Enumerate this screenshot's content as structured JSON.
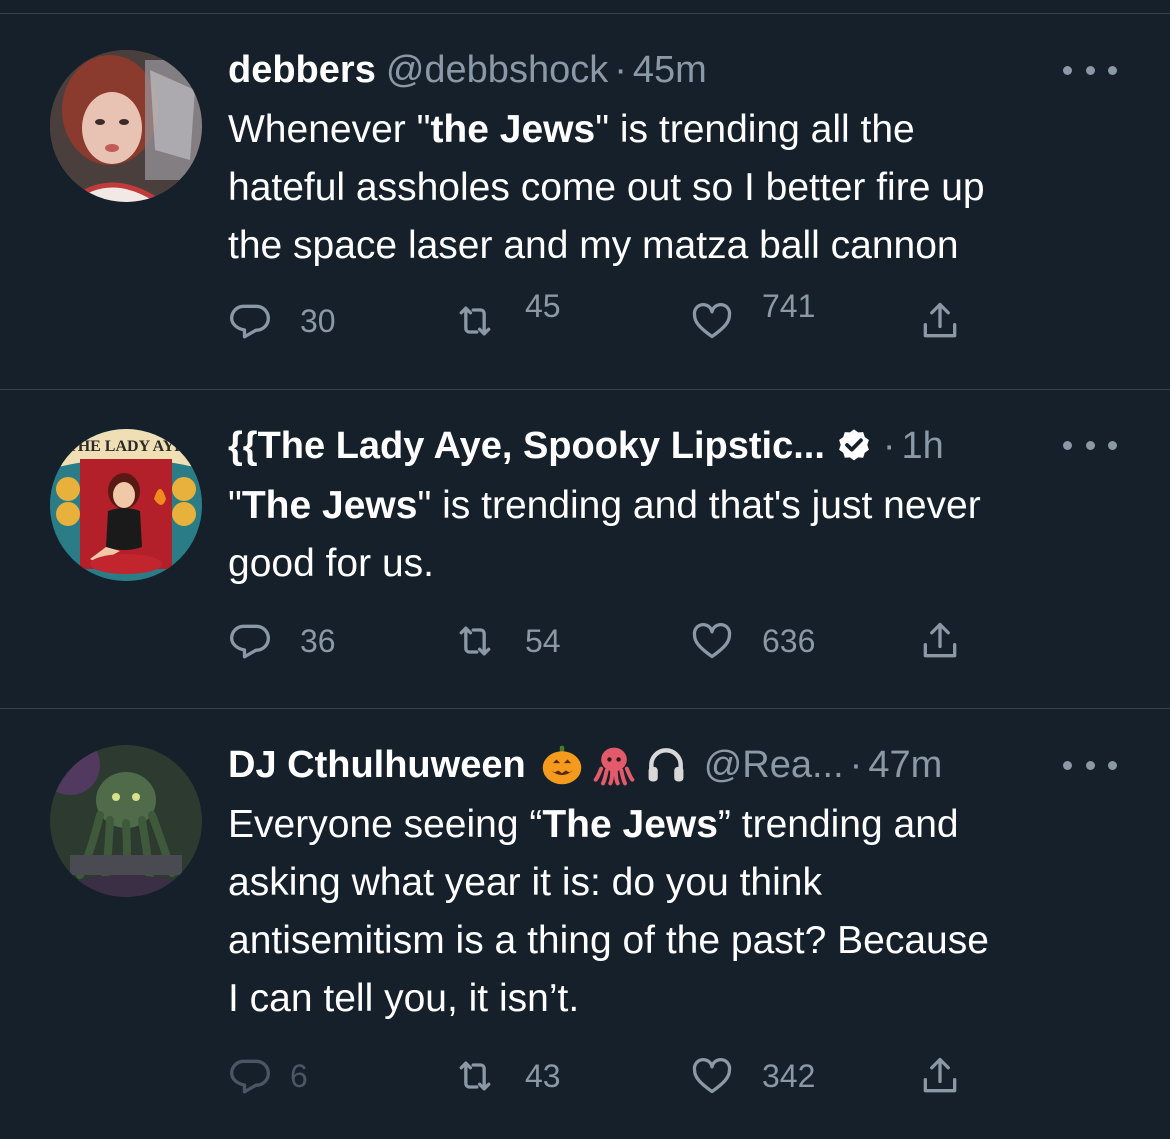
{
  "tweets": [
    {
      "display_name": "debbers",
      "handle": "@debbshock",
      "separator": "·",
      "time": "45m",
      "text_before": "Whenever \"",
      "text_bold": "the Jews",
      "text_after": "\" is trending all the\nhateful assholes come out so I better fire up\nthe space laser and my matza ball cannon",
      "replies": "30",
      "retweets": "45",
      "likes": "741",
      "verified": false,
      "avatar_icon": "avatar-photo-woman-red-hair"
    },
    {
      "display_name": "{{The Lady Aye, Spooky Lipstic...",
      "handle": "",
      "separator": "·",
      "time": "1h",
      "text_before": "\"",
      "text_bold": "The Jews",
      "text_after": "\" is trending and that's just never\ngood for us.",
      "replies": "36",
      "retweets": "54",
      "likes": "636",
      "verified": true,
      "avatar_icon": "avatar-poster-the-lady-aye",
      "avatar_text": "THE LADY AYE"
    },
    {
      "display_name": "DJ Cthulhuween",
      "handle": "@Rea...",
      "separator": "·",
      "time": "47m",
      "text_before": "Everyone seeing “",
      "text_bold": "The Jews",
      "text_after": "” trending and\nasking what year it is: do you think\nantisemitism is a thing of the past?  Because\nI can tell you, it isn’t.",
      "replies": "6",
      "retweets": "43",
      "likes": "342",
      "verified": false,
      "name_emojis": [
        "jack-o-lantern-emoji",
        "octopus-emoji",
        "headphones-emoji"
      ],
      "avatar_icon": "avatar-cthulhu-art"
    }
  ],
  "colors": {
    "background": "#15202b",
    "divider": "#38444d",
    "text_primary": "#ffffff",
    "text_secondary": "#8b98a5",
    "verified_badge": "#ffffff"
  }
}
